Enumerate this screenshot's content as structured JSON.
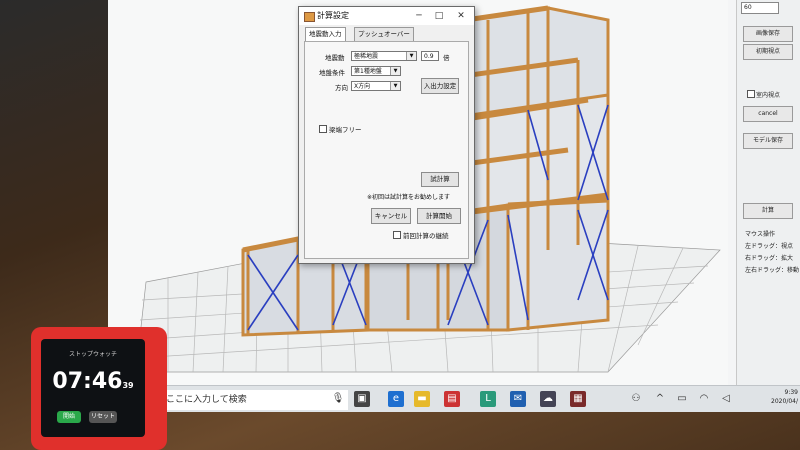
{
  "dialog": {
    "title": "計算設定",
    "tabs": [
      "地震動入力",
      "プッシュオーバー"
    ],
    "seismic_label": "地震動",
    "seismic_value": "極稀地震",
    "factor_value": "0.9",
    "factor_unit": "倍",
    "ground_label": "地盤条件",
    "ground_value": "第1種地盤",
    "direction_label": "方向",
    "direction_value": "X方向",
    "io_settings_button": "入出力設定",
    "beam_free_label": "梁端フリー",
    "trial_calc_button": "試計算",
    "note": "※初回は試計算をお勧めします",
    "cancel_button": "キャンセル",
    "start_calc_button": "計算開始",
    "continue_prev_label": "前回計算の継続"
  },
  "right_panel": {
    "input_value": "60",
    "save_image_button": "画像保存",
    "initial_view_button": "初期視点",
    "interior_view_label": "室内視点",
    "cancel_button": "cancel",
    "save_model_button": "モデル保存",
    "calc_button": "計算",
    "mouse_ops_title": "マウス操作",
    "mouse_ops": [
      "左ドラッグ：視点",
      "右ドラッグ：拡大",
      "左右ドラッグ：移動"
    ]
  },
  "taskbar": {
    "search_placeholder": "ここに入力して検索",
    "time": "9:39",
    "date": "2020/04/"
  },
  "stopwatch": {
    "label": "ストップウォッチ",
    "time_main": "07:46",
    "time_sub": "39",
    "start_button": "開始",
    "reset_button": "リセット"
  },
  "colors": {
    "frame_wood": "#c8893f",
    "brace_blue": "#2a3fc0",
    "stopwatch_red": "#e0302c"
  }
}
